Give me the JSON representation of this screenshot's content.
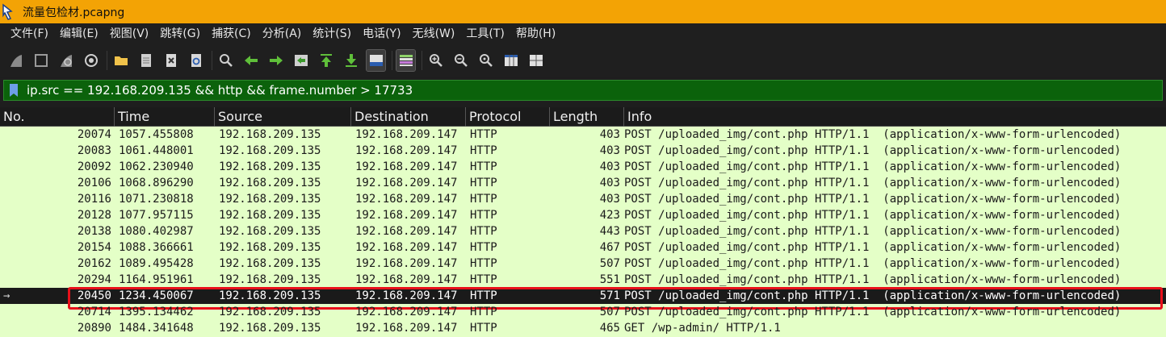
{
  "window": {
    "title": "流量包检材.pcapng"
  },
  "menu": [
    "文件(F)",
    "编辑(E)",
    "视图(V)",
    "跳转(G)",
    "捕获(C)",
    "分析(A)",
    "统计(S)",
    "电话(Y)",
    "无线(W)",
    "工具(T)",
    "帮助(H)"
  ],
  "filter": {
    "value": "ip.src == 192.168.209.135 && http && frame.number > 17733"
  },
  "colors": {
    "title_bar": "#f3a305",
    "filter_valid": "#0b620b",
    "row_http": "#e4ffc7",
    "row_selected": "#1a1a1a",
    "highlight_box": "#e8101a"
  },
  "columns": {
    "no": "No.",
    "time": "Time",
    "source": "Source",
    "destination": "Destination",
    "protocol": "Protocol",
    "length": "Length",
    "info": "Info"
  },
  "packets": [
    {
      "no": "20074",
      "time": "1057.455808",
      "source": "192.168.209.135",
      "destination": "192.168.209.147",
      "protocol": "HTTP",
      "length": "403",
      "info": "POST /uploaded_img/cont.php HTTP/1.1  (application/x-www-form-urlencoded)"
    },
    {
      "no": "20083",
      "time": "1061.448001",
      "source": "192.168.209.135",
      "destination": "192.168.209.147",
      "protocol": "HTTP",
      "length": "403",
      "info": "POST /uploaded_img/cont.php HTTP/1.1  (application/x-www-form-urlencoded)"
    },
    {
      "no": "20092",
      "time": "1062.230940",
      "source": "192.168.209.135",
      "destination": "192.168.209.147",
      "protocol": "HTTP",
      "length": "403",
      "info": "POST /uploaded_img/cont.php HTTP/1.1  (application/x-www-form-urlencoded)"
    },
    {
      "no": "20106",
      "time": "1068.896290",
      "source": "192.168.209.135",
      "destination": "192.168.209.147",
      "protocol": "HTTP",
      "length": "403",
      "info": "POST /uploaded_img/cont.php HTTP/1.1  (application/x-www-form-urlencoded)"
    },
    {
      "no": "20116",
      "time": "1071.230818",
      "source": "192.168.209.135",
      "destination": "192.168.209.147",
      "protocol": "HTTP",
      "length": "403",
      "info": "POST /uploaded_img/cont.php HTTP/1.1  (application/x-www-form-urlencoded)"
    },
    {
      "no": "20128",
      "time": "1077.957115",
      "source": "192.168.209.135",
      "destination": "192.168.209.147",
      "protocol": "HTTP",
      "length": "423",
      "info": "POST /uploaded_img/cont.php HTTP/1.1  (application/x-www-form-urlencoded)"
    },
    {
      "no": "20138",
      "time": "1080.402987",
      "source": "192.168.209.135",
      "destination": "192.168.209.147",
      "protocol": "HTTP",
      "length": "443",
      "info": "POST /uploaded_img/cont.php HTTP/1.1  (application/x-www-form-urlencoded)"
    },
    {
      "no": "20154",
      "time": "1088.366661",
      "source": "192.168.209.135",
      "destination": "192.168.209.147",
      "protocol": "HTTP",
      "length": "467",
      "info": "POST /uploaded_img/cont.php HTTP/1.1  (application/x-www-form-urlencoded)"
    },
    {
      "no": "20162",
      "time": "1089.495428",
      "source": "192.168.209.135",
      "destination": "192.168.209.147",
      "protocol": "HTTP",
      "length": "507",
      "info": "POST /uploaded_img/cont.php HTTP/1.1  (application/x-www-form-urlencoded)"
    },
    {
      "no": "20294",
      "time": "1164.951961",
      "source": "192.168.209.135",
      "destination": "192.168.209.147",
      "protocol": "HTTP",
      "length": "551",
      "info": "POST /uploaded_img/cont.php HTTP/1.1  (application/x-www-form-urlencoded)"
    },
    {
      "no": "20450",
      "time": "1234.450067",
      "source": "192.168.209.135",
      "destination": "192.168.209.147",
      "protocol": "HTTP",
      "length": "571",
      "info": "POST /uploaded_img/cont.php HTTP/1.1  (application/x-www-form-urlencoded)",
      "selected": true
    },
    {
      "no": "20714",
      "time": "1395.134462",
      "source": "192.168.209.135",
      "destination": "192.168.209.147",
      "protocol": "HTTP",
      "length": "507",
      "info": "POST /uploaded_img/cont.php HTTP/1.1  (application/x-www-form-urlencoded)"
    },
    {
      "no": "20890",
      "time": "1484.341648",
      "source": "192.168.209.135",
      "destination": "192.168.209.147",
      "protocol": "HTTP",
      "length": "465",
      "info": "GET /wp-admin/ HTTP/1.1"
    }
  ]
}
